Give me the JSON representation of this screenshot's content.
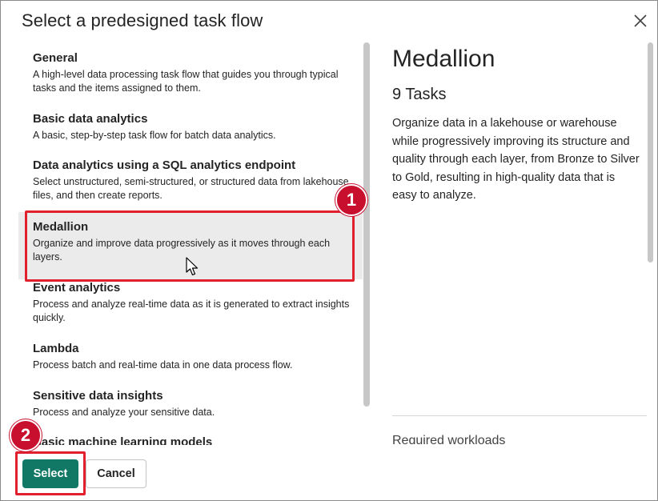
{
  "dialog": {
    "title": "Select a predesigned task flow",
    "close_icon": "close-icon"
  },
  "list": {
    "items": [
      {
        "title": "General",
        "desc": "A high-level data processing task flow that guides you through typical tasks and the items assigned to them."
      },
      {
        "title": "Basic data analytics",
        "desc": "A basic, step-by-step task flow for batch data analytics."
      },
      {
        "title": "Data analytics using a SQL analytics endpoint",
        "desc": "Select unstructured, semi-structured, or structured data from lakehouse files, and then create reports."
      },
      {
        "title": "Medallion",
        "desc": "Organize and improve data progressively as it moves through each layers."
      },
      {
        "title": "Event analytics",
        "desc": "Process and analyze real-time data as it is generated to extract insights quickly."
      },
      {
        "title": "Lambda",
        "desc": "Process batch and real-time data in one data process flow."
      },
      {
        "title": "Sensitive data insights",
        "desc": "Process and analyze your sensitive data."
      },
      {
        "title": "Basic machine learning models",
        "desc": ""
      }
    ],
    "selected_index": 3
  },
  "detail": {
    "name": "Medallion",
    "tasks": "9 Tasks",
    "description": "Organize data in a lakehouse or warehouse while progressively improving its structure and quality through each layer, from Bronze to Silver to Gold, resulting in high-quality data that is easy to analyze.",
    "workloads_label": "Required workloads"
  },
  "footer": {
    "select_label": "Select",
    "cancel_label": "Cancel"
  },
  "annotations": {
    "badge_1": "1",
    "badge_2": "2",
    "color": "#e0202d"
  },
  "colors": {
    "primary": "#117865",
    "selected_bg": "#ebebeb"
  }
}
